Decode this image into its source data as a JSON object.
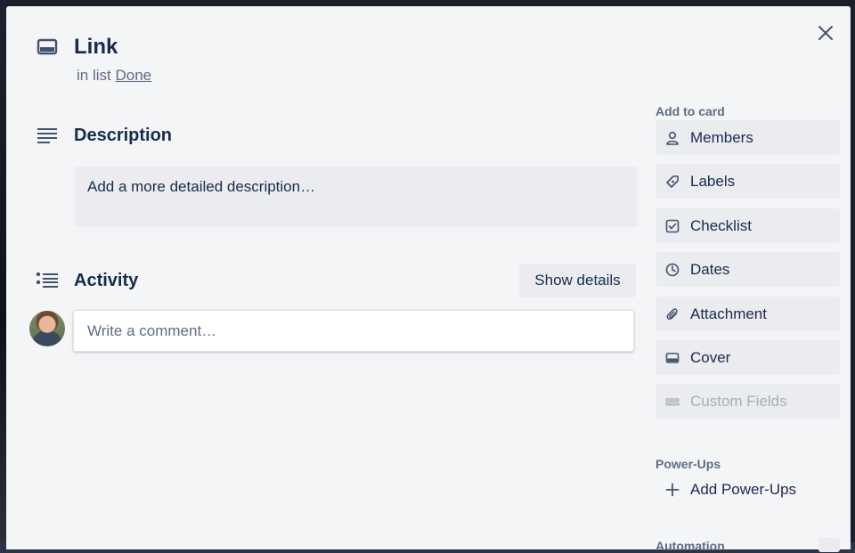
{
  "card": {
    "title": "Link",
    "in_list_prefix": "in list",
    "list_name": "Done"
  },
  "description": {
    "title": "Description",
    "placeholder": "Add a more detailed description…"
  },
  "activity": {
    "title": "Activity",
    "show_details_label": "Show details",
    "comment_placeholder": "Write a comment…"
  },
  "sidebar": {
    "add_to_card_heading": "Add to card",
    "buttons": [
      {
        "label": "Members",
        "icon": "person-icon"
      },
      {
        "label": "Labels",
        "icon": "tag-icon"
      },
      {
        "label": "Checklist",
        "icon": "checkbox-icon"
      },
      {
        "label": "Dates",
        "icon": "clock-icon"
      },
      {
        "label": "Attachment",
        "icon": "paperclip-icon"
      },
      {
        "label": "Cover",
        "icon": "card-cover-icon"
      },
      {
        "label": "Custom Fields",
        "icon": "custom-field-icon",
        "disabled": true
      }
    ],
    "powerups_heading": "Power-Ups",
    "add_powerups_label": "Add Power-Ups",
    "automation_heading": "Automation"
  },
  "colors": {
    "modal_bg": "#f4f5f7",
    "button_bg": "#ebecf0",
    "text_primary": "#172b4d",
    "text_secondary": "#5e6c84",
    "text_disabled": "#a5adba"
  }
}
